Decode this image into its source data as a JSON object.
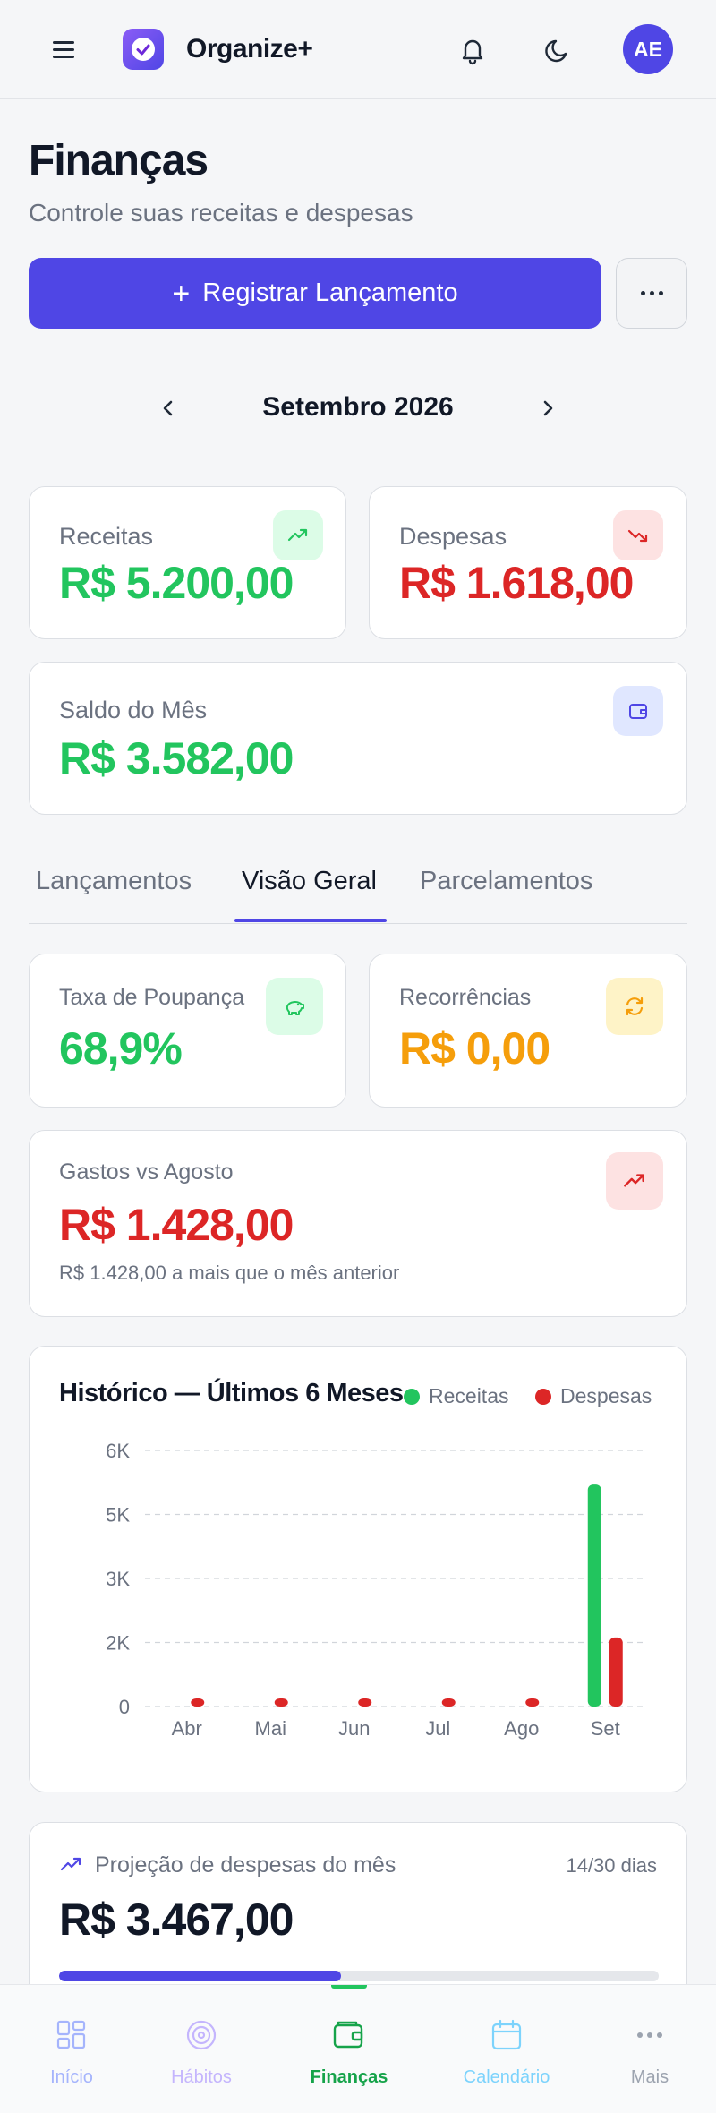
{
  "app": {
    "name": "Organize+",
    "avatar_initials": "AE"
  },
  "header": {
    "title": "Finanças",
    "subtitle": "Controle suas receitas e despesas",
    "primary_button": "Registrar Lançamento"
  },
  "period": {
    "label": "Setembro 2026"
  },
  "summary": {
    "receitas": {
      "label": "Receitas",
      "value": "R$ 5.200,00",
      "icon": "trending-up-icon",
      "color": "#22c55e"
    },
    "despesas": {
      "label": "Despesas",
      "value": "R$ 1.618,00",
      "icon": "trending-down-icon",
      "color": "#dc2626"
    },
    "saldo": {
      "label": "Saldo do Mês",
      "value": "R$ 3.582,00",
      "icon": "wallet-icon",
      "color": "#22c55e"
    }
  },
  "tabs": [
    {
      "label": "Lançamentos",
      "active": false
    },
    {
      "label": "Visão Geral",
      "active": true
    },
    {
      "label": "Parcelamentos",
      "active": false
    }
  ],
  "overview": {
    "poupanca": {
      "label": "Taxa de Poupança",
      "value": "68,9%",
      "icon": "piggy-bank-icon",
      "color": "#22c55e"
    },
    "recorrencias": {
      "label": "Recorrências",
      "value": "R$ 0,00",
      "icon": "refresh-icon",
      "color": "#f59e0b"
    },
    "comparativo": {
      "label": "Gastos vs Agosto",
      "value": "R$ 1.428,00",
      "note": "R$ 1.428,00 a mais que o mês anterior",
      "icon": "trending-up-icon",
      "color": "#dc2626"
    }
  },
  "chart_data": {
    "type": "bar",
    "title": "Histórico — Últimos 6 Meses",
    "categories": [
      "Abr",
      "Mai",
      "Jun",
      "Jul",
      "Ago",
      "Set"
    ],
    "series": [
      {
        "name": "Receitas",
        "color": "#22c55e",
        "values": [
          0,
          0,
          0,
          0,
          0,
          5200
        ]
      },
      {
        "name": "Despesas",
        "color": "#dc2626",
        "values": [
          190,
          190,
          190,
          190,
          190,
          1618
        ]
      }
    ],
    "y_ticks": [
      0,
      1500,
      3000,
      4500,
      6000
    ],
    "y_tick_labels": [
      "0",
      "2K",
      "3K",
      "5K",
      "6K"
    ],
    "ylim": [
      0,
      6000
    ],
    "grid": true,
    "legend_position": "top-right"
  },
  "projection": {
    "label": "Projeção de despesas do mês",
    "days": "14/30 dias",
    "value": "R$ 3.467,00",
    "progress": 0.47,
    "icon": "trending-up-icon"
  },
  "bottom_nav": [
    {
      "label": "Início",
      "icon": "grid-icon",
      "color": "#a5b4fc"
    },
    {
      "label": "Hábitos",
      "icon": "target-icon",
      "color": "#c4b5fd"
    },
    {
      "label": "Finanças",
      "icon": "wallet-icon",
      "color": "#16a34a",
      "active": true
    },
    {
      "label": "Calendário",
      "icon": "calendar-icon",
      "color": "#7dd3fc"
    },
    {
      "label": "Mais",
      "icon": "more-icon",
      "color": "#9ca3af"
    }
  ]
}
